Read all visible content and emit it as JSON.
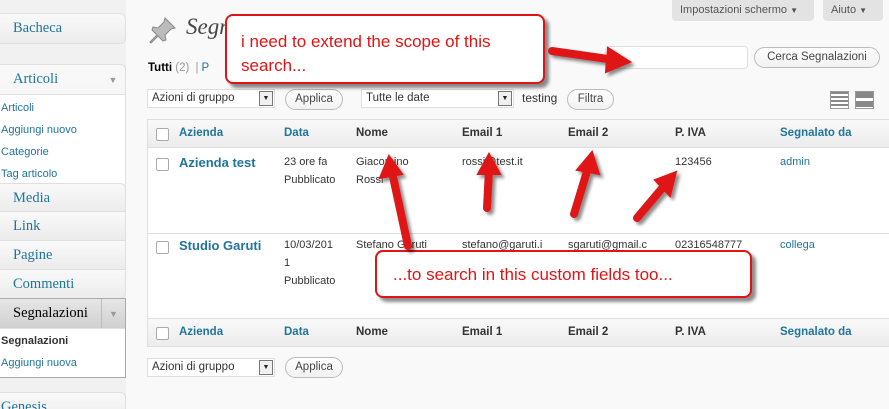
{
  "sidebar": {
    "bacheca": "Bacheca",
    "articoli": {
      "label": "Articoli",
      "items": [
        "Articoli",
        "Aggiungi nuovo",
        "Categorie",
        "Tag articolo"
      ]
    },
    "media": "Media",
    "link": "Link",
    "pagine": "Pagine",
    "commenti": "Commenti",
    "segnalazioni": {
      "label": "Segnalazioni",
      "items": [
        "Segnalazioni",
        "Aggiungi nuova"
      ]
    },
    "genesis": "Genesis"
  },
  "header": {
    "screen_options": "Impostazioni schermo",
    "help": "Aiuto",
    "title": "Segnalazioni"
  },
  "subsubsub": {
    "all_label": "Tutti",
    "all_count": "(2)",
    "sep": "|",
    "next": "P"
  },
  "search": {
    "value": "",
    "button": "Cerca Segnalazioni"
  },
  "filters": {
    "bulk_actions": "Azioni di gruppo",
    "apply": "Applica",
    "dates": "Tutte le date",
    "extra_text": "testing",
    "filter": "Filtra"
  },
  "table": {
    "columns": [
      "Azienda",
      "Data",
      "Nome",
      "Email 1",
      "Email 2",
      "P. IVA",
      "Segnalato da"
    ],
    "rows": [
      {
        "azienda": "Azienda test",
        "data": "23 ore fa",
        "status": "Pubblicato",
        "nome1": "Giacomino",
        "nome2": "Rossi",
        "email1": "rossi@test.it",
        "email2": "",
        "piva": "123456",
        "segnalato": "admin"
      },
      {
        "azienda": "Studio Garuti",
        "data": "10/03/201",
        "data2": "1",
        "status": "Pubblicato",
        "nome1": "Stefano Garuti",
        "nome2": "",
        "email1": "stefano@garuti.i",
        "email2": "sgaruti@gmail.c",
        "piva": "02316548777",
        "segnalato": "collega"
      }
    ]
  },
  "annotations": {
    "top": "i need to extend the scope of this search...",
    "bottom": "...to search in this custom fields too..."
  },
  "colors": {
    "accent": "#21759b",
    "annotation": "#e01414"
  }
}
